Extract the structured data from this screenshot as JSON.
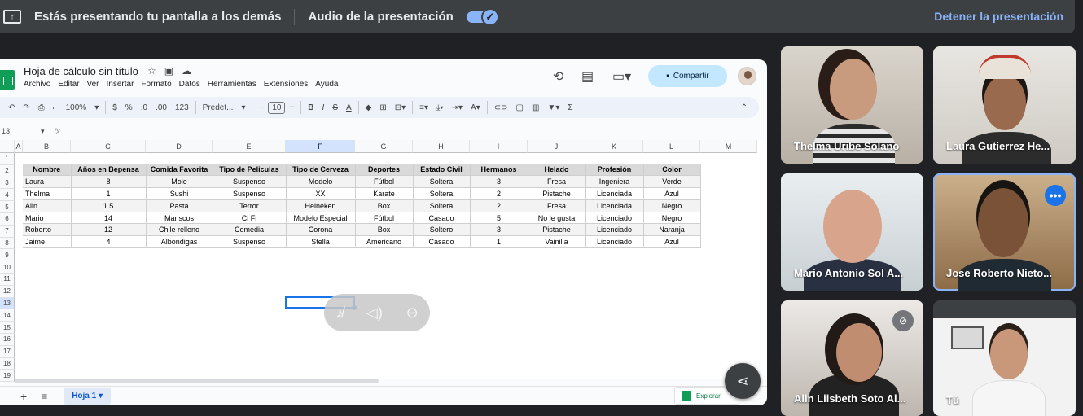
{
  "topbar": {
    "present_text": "Estás presentando tu pantalla a los demás",
    "audio_text": "Audio de la presentación",
    "audio_enabled": true,
    "stop_label": "Detener la presentación"
  },
  "sheets": {
    "title": "Hoja de cálculo sin título",
    "menu": [
      "Archivo",
      "Editar",
      "Ver",
      "Insertar",
      "Formato",
      "Datos",
      "Herramientas",
      "Extensiones",
      "Ayuda"
    ],
    "share_label": "Compartir",
    "toolbar": {
      "zoom": "100%",
      "currency": "$",
      "percent": "%",
      "dec_decrease": ".0",
      "dec_increase": ".00",
      "format_123": "123",
      "font": "Predet...",
      "font_size": "10"
    },
    "name_box": "13",
    "fx": "fx",
    "columns": [
      "A",
      "B",
      "C",
      "D",
      "E",
      "F",
      "G",
      "H",
      "I",
      "J",
      "K",
      "L",
      "M"
    ],
    "rows": [
      "1",
      "2",
      "3",
      "4",
      "5",
      "6",
      "7",
      "8",
      "9",
      "10",
      "11",
      "12",
      "13",
      "14",
      "15",
      "16",
      "17",
      "18",
      "19"
    ],
    "table": {
      "headers": [
        "Nombre",
        "Años en Bepensa",
        "Comida Favorita",
        "Tipo de Peliculas",
        "Tipo de Cerveza",
        "Deportes",
        "Estado Civil",
        "Hermanos",
        "Helado",
        "Profesión",
        "Color"
      ],
      "rows": [
        [
          "Laura",
          "8",
          "Mole",
          "Suspenso",
          "Modelo",
          "Fútbol",
          "Soltera",
          "3",
          "Fresa",
          "Ingeniera",
          "Verde"
        ],
        [
          "Thelma",
          "1",
          "Sushi",
          "Suspenso",
          "XX",
          "Karate",
          "Soltera",
          "2",
          "Pistache",
          "Licenciada",
          "Azul"
        ],
        [
          "Alin",
          "1.5",
          "Pasta",
          "Terror",
          "Heineken",
          "Box",
          "Soltera",
          "2",
          "Fresa",
          "Licenciada",
          "Negro"
        ],
        [
          "Mario",
          "14",
          "Mariscos",
          "Ci Fi",
          "Modelo Especial",
          "Fútbol",
          "Casado",
          "5",
          "No le gusta",
          "Licenciado",
          "Negro"
        ],
        [
          "Roberto",
          "12",
          "Chile relleno",
          "Comedia",
          "Corona",
          "Box",
          "Soltero",
          "3",
          "Pistache",
          "Licenciado",
          "Naranja"
        ],
        [
          "Jaime",
          "4",
          "Albondigas",
          "Suspenso",
          "Stella",
          "Americano",
          "Casado",
          "1",
          "Vainilla",
          "Licenciado",
          "Azul"
        ]
      ]
    },
    "sheet_tab": "Hoja 1",
    "explore_label": "Explorar"
  },
  "participants": [
    {
      "name": "Thelma Uribe Solano"
    },
    {
      "name": "Laura Gutierrez He..."
    },
    {
      "name": "Mario Antonio Sol A..."
    },
    {
      "name": "Jose Roberto Nieto..."
    },
    {
      "name": "Alin Liisbeth Soto Al..."
    },
    {
      "name": "Tú"
    }
  ],
  "colors": {
    "background": "#202124",
    "accent": "#8ab4f8",
    "sheets_green": "#0f9d58",
    "share_button": "#c2e7ff"
  }
}
